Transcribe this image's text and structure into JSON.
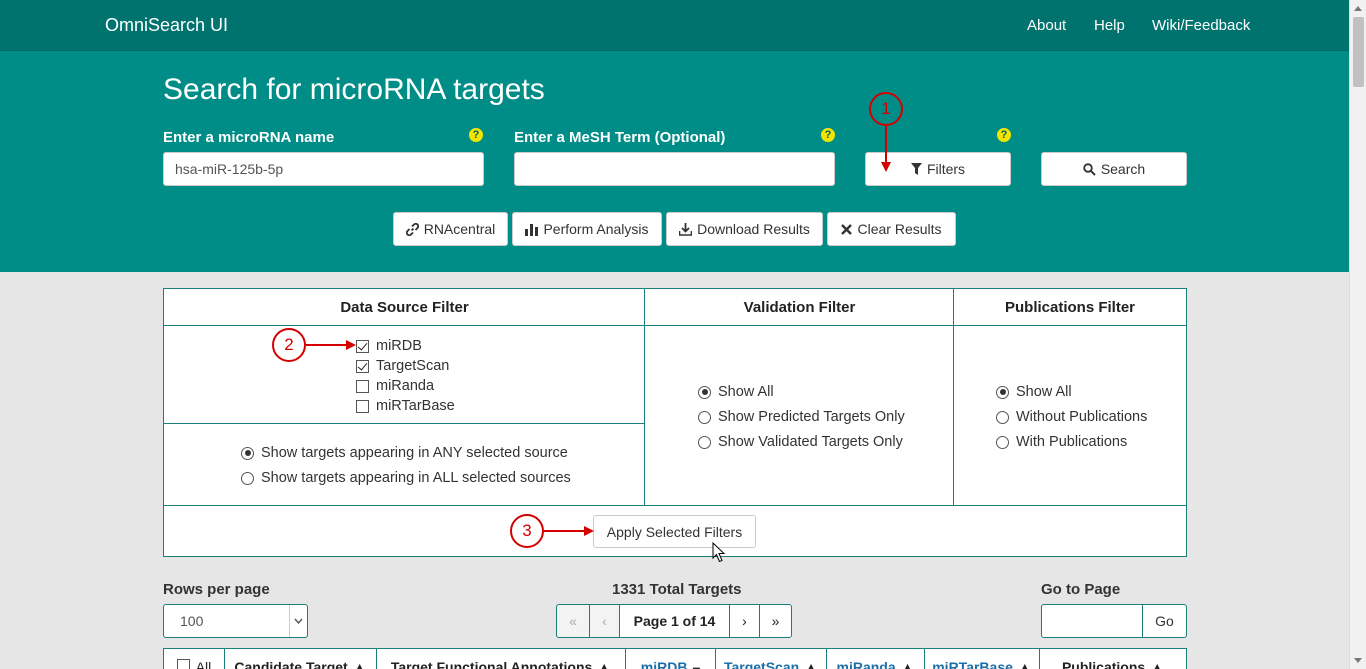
{
  "navbar": {
    "brand": "OmniSearch UI",
    "links": [
      "About",
      "Help",
      "Wiki/Feedback"
    ],
    "background": "#00736f"
  },
  "hero": {
    "title": "Search for microRNA targets",
    "background": "#008d87",
    "mirna_label": "Enter a microRNA name",
    "mirna_value": "hsa-miR-125b-5p",
    "mesh_label": "Enter a MeSH Term (Optional)",
    "mesh_value": "",
    "help_glyph": "?",
    "filters_button": "Filters",
    "search_button": "Search",
    "actions": [
      "RNAcentral",
      "Perform Analysis",
      "Download Results",
      "Clear Results"
    ]
  },
  "annotations": [
    "1",
    "2",
    "3"
  ],
  "filters": {
    "data_source": {
      "title": "Data Source Filter",
      "sources": [
        {
          "label": "miRDB",
          "checked": true
        },
        {
          "label": "TargetScan",
          "checked": true
        },
        {
          "label": "miRanda",
          "checked": false
        },
        {
          "label": "miRTarBase",
          "checked": false
        }
      ],
      "mode_options": [
        {
          "label": "Show targets appearing in ANY selected source",
          "checked": true
        },
        {
          "label": "Show targets appearing in ALL selected sources",
          "checked": false
        }
      ]
    },
    "validation": {
      "title": "Validation Filter",
      "options": [
        {
          "label": "Show All",
          "checked": true
        },
        {
          "label": "Show Predicted Targets Only",
          "checked": false
        },
        {
          "label": "Show Validated Targets Only",
          "checked": false
        }
      ]
    },
    "publications": {
      "title": "Publications Filter",
      "options": [
        {
          "label": "Show All",
          "checked": true
        },
        {
          "label": "Without Publications",
          "checked": false
        },
        {
          "label": "With Publications",
          "checked": false
        }
      ]
    },
    "apply_button": "Apply Selected Filters"
  },
  "pager": {
    "rows_label": "Rows per page",
    "rows_value": "100",
    "total": "1331 Total Targets",
    "first": "«",
    "prev": "‹",
    "current": "Page 1 of 14",
    "next": "›",
    "last": "»",
    "goto_label": "Go to Page",
    "goto_value": "",
    "go_button": "Go"
  },
  "table": {
    "all_label": "All",
    "columns": [
      "Candidate Target",
      "Target Functional Annotations",
      "miRDB",
      "TargetScan",
      "miRanda",
      "miRTarBase",
      "Publications"
    ]
  },
  "colors": {
    "accent": "#1a7f7b",
    "annotation": "#d40000",
    "help": "#f2e600",
    "link": "#1a6fa8"
  }
}
